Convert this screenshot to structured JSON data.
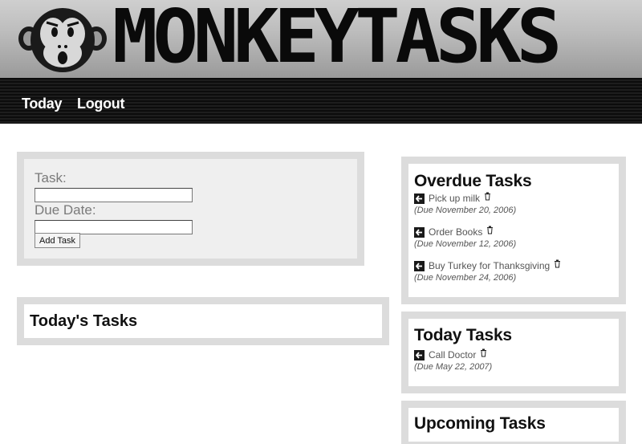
{
  "header": {
    "logo_text": "MONKEYTASKS"
  },
  "nav": {
    "today": "Today",
    "logout": "Logout"
  },
  "form": {
    "task_label": "Task:",
    "task_value": "",
    "due_label": "Due Date:",
    "due_value": "",
    "submit_label": "Add Task"
  },
  "todays_tasks": {
    "title": "Today's Tasks"
  },
  "overdue": {
    "title": "Overdue Tasks",
    "tasks": [
      {
        "name": "Pick up milk",
        "due": "(Due November 20, 2006)"
      },
      {
        "name": "Order Books",
        "due": "(Due November 12, 2006)"
      },
      {
        "name": "Buy Turkey for Thanksgiving",
        "due": "(Due November 24, 2006)"
      }
    ]
  },
  "today": {
    "title": "Today Tasks",
    "tasks": [
      {
        "name": "Call Doctor",
        "due": "(Due May 22, 2007)"
      }
    ]
  },
  "upcoming": {
    "title": "Upcoming Tasks"
  },
  "icons": {
    "logo": "monkey-face-icon",
    "move": "left-arrow-icon",
    "delete": "trash-icon"
  }
}
